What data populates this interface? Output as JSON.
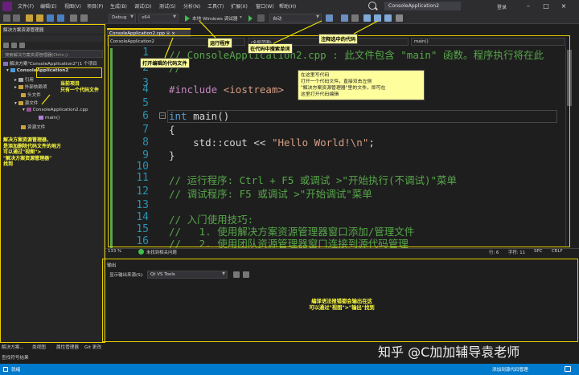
{
  "menu": [
    "文件(F)",
    "编辑(E)",
    "视图(V)",
    "项目(P)",
    "生成(B)",
    "调试(D)",
    "测试(S)",
    "分析(N)",
    "工具(T)",
    "扩展(X)",
    "窗口(W)",
    "帮助(H)"
  ],
  "window": {
    "title": "ConsoleApplication2",
    "login": "登录"
  },
  "toolbar": {
    "config": "Debug",
    "platform": "x64",
    "run_label": "本地 Windows 调试器",
    "auto_label": "自动"
  },
  "solution_explorer": {
    "title": "解决方案资源管理器",
    "search_placeholder": "搜索解决方案资源管理器(Ctrl+;)",
    "tree": [
      "解决方案\"ConsoleApplication2\"(1 个项目",
      "ConsoleApplication2",
      "引用",
      "外部依赖项",
      "头文件",
      "源文件",
      "ConsoleApplication2.cpp",
      "main()",
      "资源文件"
    ]
  },
  "notes": {
    "current_project": "当前项目\n只有一个代码文件",
    "solution_explorer_note": "解决方案资源管理器，\n是添加删除代码文件的地方\n可以通过\"视图\">\n\"解决方案资源管理器\"\n找到",
    "open_file": "打开编辑的代码文件",
    "run": "运行程序",
    "search": "在代码中搜索单词",
    "comment": "注释选中的代码",
    "write_code": "在这里写代码\n打开一个代码文件，直接双击左侧\n\"解决方案资源管理器\"里的文件，即可在\n这里打开代码编辑",
    "output_note": "编译语法报错都会输出在这\n可以通过\"视图\">\"输出\"找到"
  },
  "editor": {
    "tab": "ConsoleApplication2.cpp",
    "nav": [
      "ConsoleApplication2",
      "(全局范围)",
      "main()"
    ],
    "lines": [
      {
        "n": "1",
        "text": "// ConsoleApplication2.cpp : 此文件包含 \"main\" 函数。程序执行将在此"
      },
      {
        "n": "2",
        "text": "//"
      },
      {
        "n": "3",
        "text": ""
      },
      {
        "n": "4",
        "text": "#include <iostream>"
      },
      {
        "n": "5",
        "text": ""
      },
      {
        "n": "6",
        "text": "int main()"
      },
      {
        "n": "7",
        "text": "{"
      },
      {
        "n": "8",
        "text": "    std::cout << \"Hello World!\\n\";"
      },
      {
        "n": "9",
        "text": "}"
      },
      {
        "n": "10",
        "text": ""
      },
      {
        "n": "11",
        "text": "// 运行程序: Ctrl + F5 或调试 >\"开始执行(不调试)\"菜单"
      },
      {
        "n": "12",
        "text": "// 调试程序: F5 或调试 >\"开始调试\"菜单"
      },
      {
        "n": "13",
        "text": ""
      },
      {
        "n": "14",
        "text": "// 入门使用技巧:"
      },
      {
        "n": "15",
        "text": "//   1. 使用解决方案资源管理器窗口添加/管理文件"
      },
      {
        "n": "16",
        "text": "//   2. 使用团队资源管理器窗口连接到源代码管理"
      }
    ],
    "status": {
      "zoom": "133 %",
      "issues": "未找到相关问题",
      "row": "行: 6",
      "col": "字符: 11",
      "spc": "SPC",
      "eol": "CRLF"
    }
  },
  "output": {
    "title": "输出",
    "source_label": "显示输出来源(S):",
    "source_value": "Qt VS Tools"
  },
  "bottom_tabs": [
    "解决方案...",
    "类视图",
    "属性管理器",
    "Git 更改"
  ],
  "find_results": "查找符号结果",
  "status": {
    "ready": "就绪",
    "source_control": "添加到源代码管理"
  },
  "watermark": "知乎 @C加加辅导袁老师",
  "colors": {
    "accent": "#007acc",
    "annotation": "#e8d000",
    "note_bg": "#fefe9c"
  }
}
